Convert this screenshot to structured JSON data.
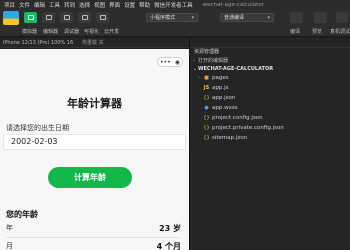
{
  "menubar": {
    "items": [
      "项目",
      "文件",
      "编辑",
      "工具",
      "转到",
      "选择",
      "视图",
      "界面",
      "设置",
      "帮助",
      "微信开发者工具"
    ],
    "title": "wechat-age-calculator"
  },
  "toolbar": {
    "labels": [
      "模拟器",
      "编辑器",
      "调试器",
      "可视化",
      "云开发"
    ],
    "mode_select": "小程序模式",
    "compile_select": "普通编译",
    "compile_label": "编译",
    "preview_label": "预览",
    "remote_label": "真机调试"
  },
  "simulator": {
    "device": "iPhone 12/13 (Pro) 100% 16",
    "zoom": "热重载",
    "hot": "热重载 关",
    "status_bar": "",
    "capsule_dots": "•••",
    "capsule_close": "◉",
    "app_title": "年龄计算器",
    "birth_label": "请选择您的出生日期",
    "birth_value": "2002-02-03",
    "calc_button": "计算年龄",
    "your_age": "您的年龄",
    "year_label": "年",
    "year_value": "23 岁",
    "month_label": "月",
    "month_value": "4 个月"
  },
  "explorer": {
    "header": "资源管理器",
    "open_editors": "打开的编辑器",
    "project": "WECHAT-AGE-CALCULATOR",
    "files": [
      {
        "name": "pages",
        "type": "folder"
      },
      {
        "name": "app.js",
        "type": "js"
      },
      {
        "name": "app.json",
        "type": "json"
      },
      {
        "name": "app.wxss",
        "type": "wxss"
      },
      {
        "name": "project.config.json",
        "type": "json"
      },
      {
        "name": "project.private.config.json",
        "type": "json"
      },
      {
        "name": "sitemap.json",
        "type": "json"
      }
    ]
  },
  "colors": {
    "accent_green": "#14b84a",
    "toolbar_green": "#07c160"
  }
}
